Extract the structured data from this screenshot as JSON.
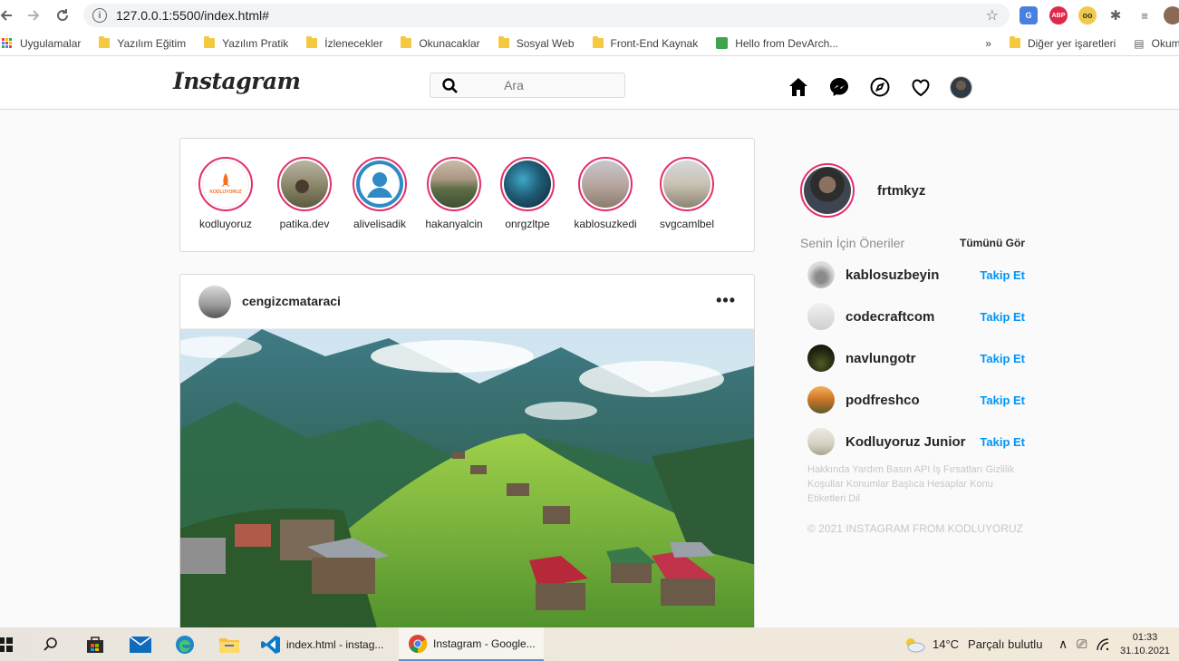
{
  "browser": {
    "url": "127.0.0.1:5500/index.html#",
    "bookmarks": [
      "Uygulamalar",
      "Yazılım Eğitim",
      "Yazılım Pratik",
      "İzlenecekler",
      "Okunacaklar",
      "Sosyal Web",
      "Front-End Kaynak",
      "Hello from DevArch...",
      "»",
      "Diğer yer işaretleri",
      "Okuma"
    ]
  },
  "header": {
    "logo": "Instagram",
    "search_placeholder": "Ara"
  },
  "stories": [
    {
      "name": "kodluyoruz"
    },
    {
      "name": "patika.dev"
    },
    {
      "name": "alivelisadik"
    },
    {
      "name": "hakanyalcin"
    },
    {
      "name": "onrgzltpe"
    },
    {
      "name": "kablosuzkedi"
    },
    {
      "name": "svgcamlbel"
    }
  ],
  "story_logo_text": "KODLUYORUZ",
  "post": {
    "username": "cengizcmataraci",
    "more": "•••"
  },
  "sidebar": {
    "username": "frtmkyz",
    "suggestions_title": "Senin İçin Öneriler",
    "see_all": "Tümünü Gör",
    "follow_label": "Takip Et",
    "suggestions": [
      {
        "name": "kablosuzbeyin"
      },
      {
        "name": "codecraftcom"
      },
      {
        "name": "navlungotr"
      },
      {
        "name": "podfreshco"
      },
      {
        "name": "Kodluyoruz Junior"
      }
    ],
    "footer_links": "Hakkında Yardım Basın API İş Fırsatları Gizlilik Koşullar Konumlar Başlıca Hesaplar Konu Etiketleri Dil",
    "copyright": "© 2021 INSTAGRAM FROM KODLUYORUZ"
  },
  "taskbar": {
    "tasks": [
      "index.html - instag...",
      "Instagram - Google..."
    ],
    "weather": "14°C",
    "weather_text": "Parçalı bulutlu",
    "time": "01:33",
    "date": "31.10.2021"
  }
}
